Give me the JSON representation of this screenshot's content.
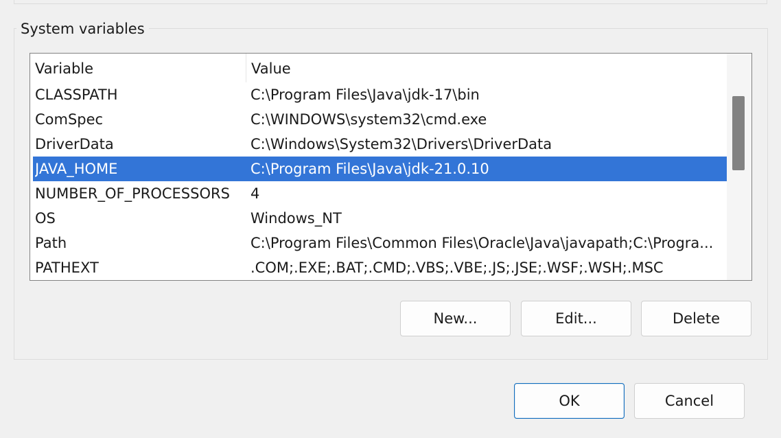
{
  "group_title": "System variables",
  "columns": {
    "variable": "Variable",
    "value": "Value"
  },
  "rows": [
    {
      "variable": "CLASSPATH",
      "value": "C:\\Program Files\\Java\\jdk-17\\bin"
    },
    {
      "variable": "ComSpec",
      "value": "C:\\WINDOWS\\system32\\cmd.exe"
    },
    {
      "variable": "DriverData",
      "value": "C:\\Windows\\System32\\Drivers\\DriverData"
    },
    {
      "variable": "JAVA_HOME",
      "value": "C:\\Program Files\\Java\\jdk-21.0.10",
      "selected": true
    },
    {
      "variable": "NUMBER_OF_PROCESSORS",
      "value": "4"
    },
    {
      "variable": "OS",
      "value": "Windows_NT"
    },
    {
      "variable": "Path",
      "value": "C:\\Program Files\\Common Files\\Oracle\\Java\\javapath;C:\\Progra..."
    },
    {
      "variable": "PATHEXT",
      "value": ".COM;.EXE;.BAT;.CMD;.VBS;.VBE;.JS;.JSE;.WSF;.WSH;.MSC"
    }
  ],
  "buttons": {
    "new": "New...",
    "edit": "Edit...",
    "delete": "Delete",
    "ok": "OK",
    "cancel": "Cancel"
  },
  "colors": {
    "selection": "#3375d7",
    "default_button_border": "#0f6cbd",
    "scroll_thumb": "#828282"
  }
}
